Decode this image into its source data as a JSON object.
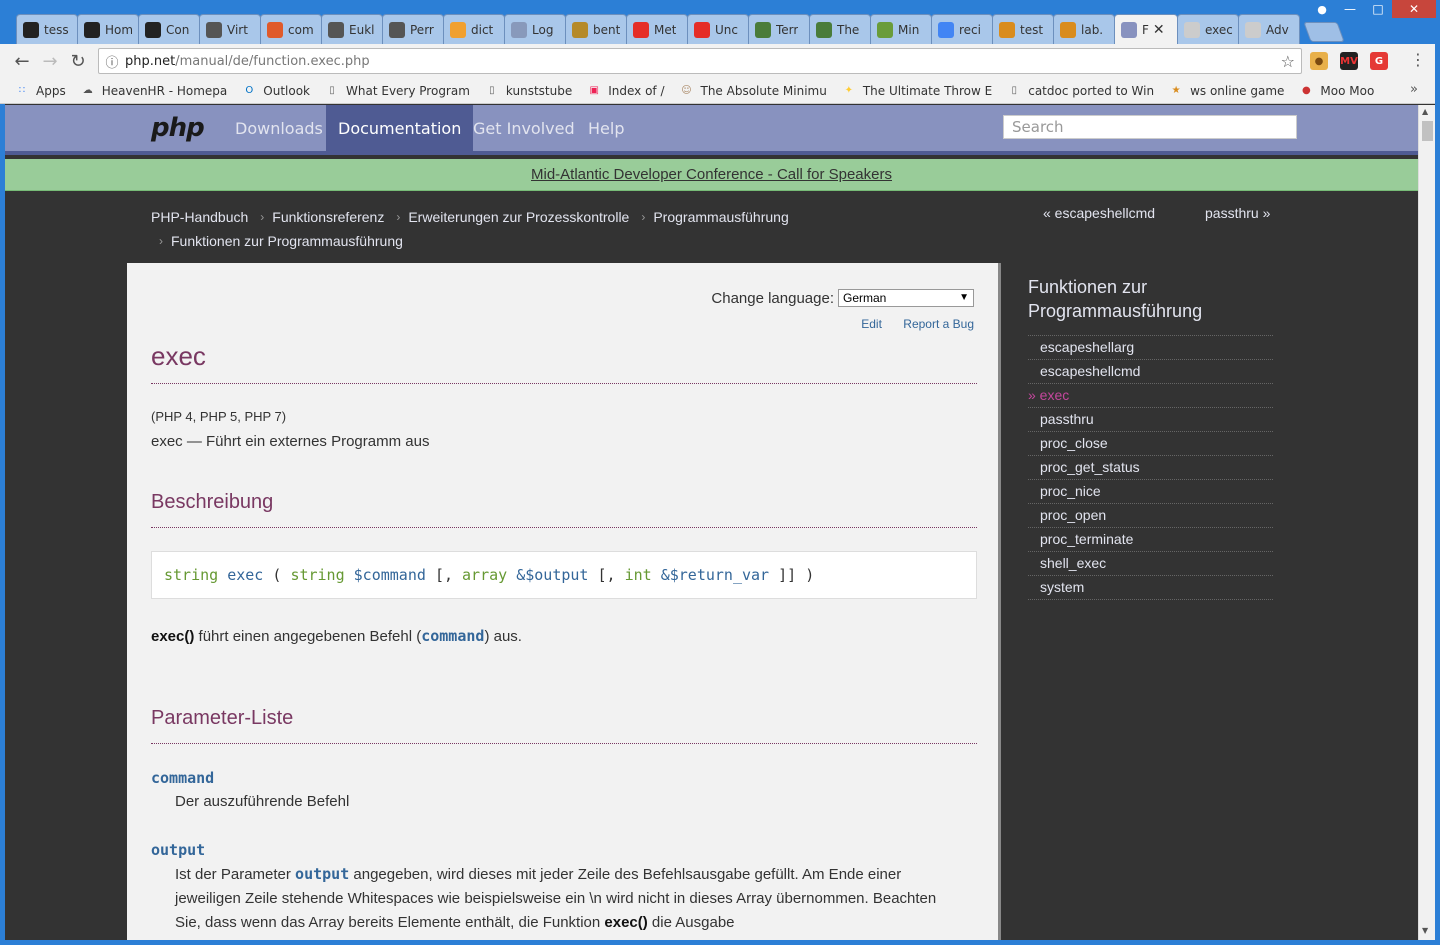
{
  "browser": {
    "tabs": [
      {
        "label": "tess",
        "icon": "github-icon",
        "color": "#222222"
      },
      {
        "label": "Hom",
        "icon": "github-icon",
        "color": "#222222"
      },
      {
        "label": "Con",
        "icon": "github-icon",
        "color": "#222222"
      },
      {
        "label": "Virt",
        "icon": "wikipedia-icon",
        "color": "#555555"
      },
      {
        "label": "com",
        "icon": "ask-icon",
        "color": "#e05a2b"
      },
      {
        "label": "Eukl",
        "icon": "wikipedia-icon",
        "color": "#555555"
      },
      {
        "label": "Perr",
        "icon": "wikipedia-icon",
        "color": "#555555"
      },
      {
        "label": "dict",
        "icon": "dict-icon",
        "color": "#f0a030"
      },
      {
        "label": "Log",
        "icon": "question-icon",
        "color": "#8899bb"
      },
      {
        "label": "bent",
        "icon": "bent-icon",
        "color": "#b58a2a"
      },
      {
        "label": "Met",
        "icon": "youtube-icon",
        "color": "#e52d27"
      },
      {
        "label": "Unc",
        "icon": "youtube-icon",
        "color": "#e52d27"
      },
      {
        "label": "Terr",
        "icon": "minecraft-icon",
        "color": "#4a7c3a"
      },
      {
        "label": "The",
        "icon": "minecraft-icon",
        "color": "#4a7c3a"
      },
      {
        "label": "Min",
        "icon": "minecraft-icon",
        "color": "#6a9c3a"
      },
      {
        "label": "reci",
        "icon": "google-icon",
        "color": "#4285f4"
      },
      {
        "label": "test",
        "icon": "star-icon",
        "color": "#d98c1e"
      },
      {
        "label": "lab.",
        "icon": "star-icon",
        "color": "#d98c1e"
      }
    ],
    "active_tab": {
      "label": "F",
      "icon": "php-icon",
      "color": "#8892bf"
    },
    "trailing_tabs": [
      {
        "label": "exec",
        "icon": "page-icon",
        "color": "#cccccc"
      },
      {
        "label": "Adv",
        "icon": "page-icon",
        "color": "#cccccc"
      }
    ],
    "url_host": "php.net",
    "url_path": "/manual/de/function.exec.php",
    "bookmarks": [
      {
        "label": "Apps",
        "icon": "apps-grid-icon"
      },
      {
        "label": "HeavenHR - Homepa",
        "icon": "cloud-icon"
      },
      {
        "label": "Outlook",
        "icon": "outlook-icon"
      },
      {
        "label": "What Every Program",
        "icon": "page-icon"
      },
      {
        "label": "kunststube",
        "icon": "page-icon"
      },
      {
        "label": "Index of /",
        "icon": "index-icon"
      },
      {
        "label": "The Absolute Minimu",
        "icon": "person-icon"
      },
      {
        "label": "The Ultimate Throw E",
        "icon": "throw-icon"
      },
      {
        "label": "catdoc ported to Win",
        "icon": "page-icon"
      },
      {
        "label": "ws online game",
        "icon": "star-icon"
      },
      {
        "label": "Moo Moo",
        "icon": "apple-icon"
      }
    ],
    "bookmarks_more": "»"
  },
  "site": {
    "logo": "php",
    "nav": [
      "Downloads",
      "Documentation",
      "Get Involved",
      "Help"
    ],
    "search_placeholder": "Search",
    "banner": "Mid-Atlantic Developer Conference - Call for Speakers"
  },
  "breadcrumbs": {
    "row1": [
      "PHP-Handbuch",
      "Funktionsreferenz",
      "Erweiterungen zur Prozesskontrolle",
      "Programmausführung"
    ],
    "row2": [
      "Funktionen zur Programmausführung"
    ],
    "prev": "« escapeshellcmd",
    "next": "passthru »"
  },
  "page": {
    "change_language_label": "Change language:",
    "language": "German",
    "edit": "Edit",
    "report_bug": "Report a Bug",
    "title": "exec",
    "versions": "(PHP 4, PHP 5, PHP 7)",
    "refpurpose": "exec — Führt ein externes Programm aus",
    "h_description": "Beschreibung",
    "synopsis": {
      "ret_type": "string",
      "name": "exec",
      "p1_type": "string",
      "p1": "$command",
      "p2_type": "array",
      "p2": "&$output",
      "p3_type": "int",
      "p3": "&$return_var"
    },
    "desc_fn": "exec()",
    "desc_text1": " führt einen angegebenen Befehl (",
    "desc_param": "command",
    "desc_text2": ") aus.",
    "h_params": "Parameter-Liste",
    "param1_name": "command",
    "param1_desc": "Der auszuführende Befehl",
    "param2_name": "output",
    "param2_desc_a": "Ist der Parameter ",
    "param2_desc_code": "output",
    "param2_desc_b": " angegeben, wird dieses mit jeder Zeile des Befehlsausgabe gefüllt. Am Ende einer jeweiligen Zeile stehende Whitespaces wie beispielsweise ein \\n wird nicht in dieses Array übernommen. Beachten Sie, dass wenn das Array bereits Elemente enthält, die Funktion ",
    "param2_desc_fn": "exec()",
    "param2_desc_c": " die Ausgabe"
  },
  "sidebar": {
    "title": "Funktionen zur Programmausführung",
    "items": [
      "escapeshellarg",
      "escapeshellcmd",
      "» exec",
      "passthru",
      "proc_close",
      "proc_get_status",
      "proc_nice",
      "proc_open",
      "proc_terminate",
      "shell_exec",
      "system"
    ],
    "current_index": 2
  }
}
